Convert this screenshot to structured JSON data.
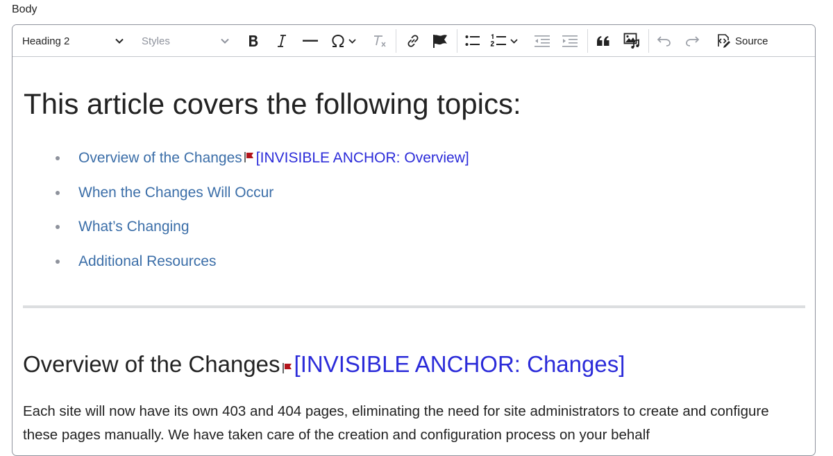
{
  "field": {
    "label": "Body"
  },
  "toolbar": {
    "heading_dropdown": "Heading 2",
    "styles_dropdown": "Styles",
    "source_label": "Source",
    "icons": [
      "bold-icon",
      "italic-icon",
      "horizontal-line-icon",
      "special-characters-icon",
      "remove-format-icon",
      "link-icon",
      "anchor-flag-icon",
      "bulleted-list-icon",
      "numbered-list-icon",
      "outdent-icon",
      "indent-icon",
      "blockquote-icon",
      "media-icon",
      "undo-icon",
      "redo-icon",
      "source-icon"
    ]
  },
  "content": {
    "heading": "This article covers the following topics:",
    "topics": [
      {
        "label": "Overview of the Changes",
        "anchor": "[INVISIBLE ANCHOR: Overview]"
      },
      {
        "label": "When the Changes Will Occur"
      },
      {
        "label": "What’s Changing"
      },
      {
        "label": "Additional Resources"
      }
    ],
    "section": {
      "heading": "Overview of the Changes",
      "anchor": "[INVISIBLE ANCHOR: Changes]",
      "paragraph": "Each site will now have its own 403 and 404 pages, eliminating the need for site administrators to create and configure these pages manually. We have taken care of the creation and configuration process on your behalf"
    }
  },
  "colors": {
    "link": "#3b6ea8",
    "anchor_text": "#2b2bd9",
    "anchor_flag": "#b3141b",
    "border": "#8e929c"
  }
}
